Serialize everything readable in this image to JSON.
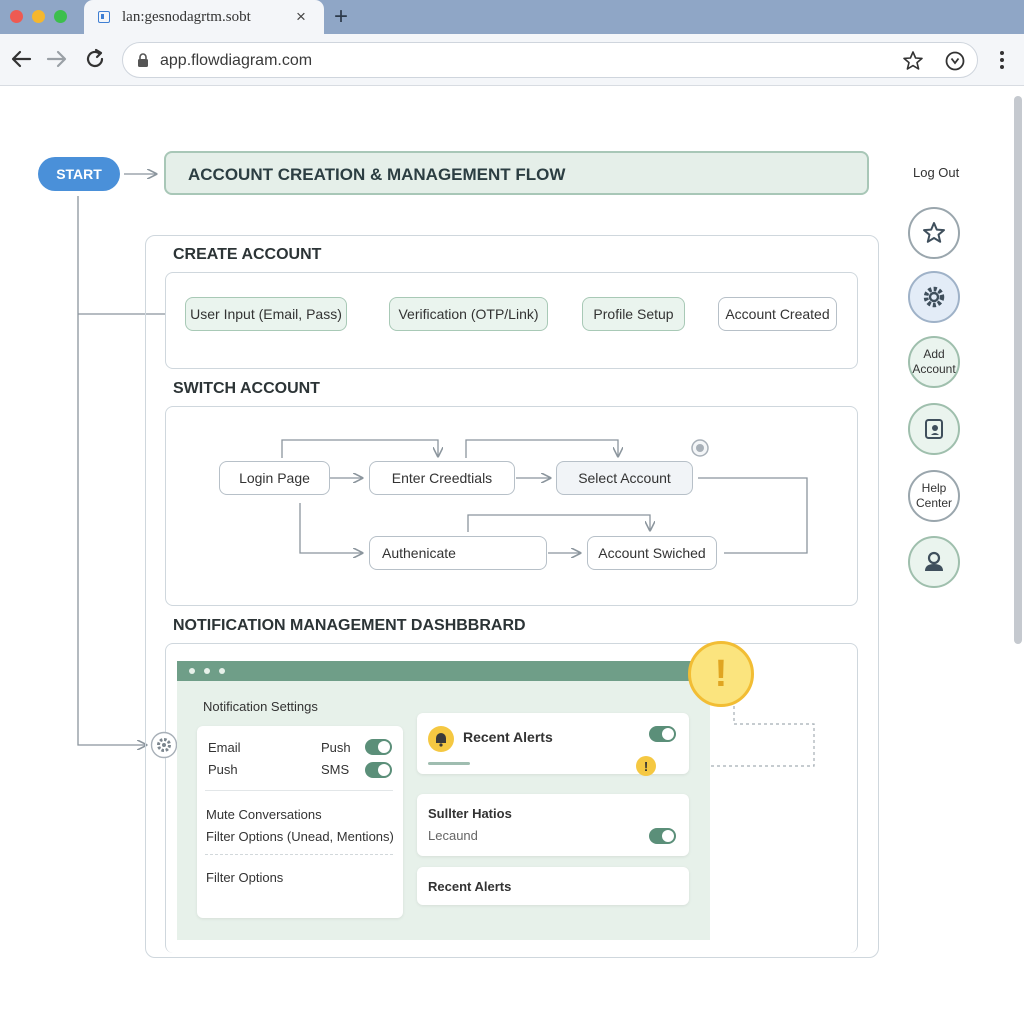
{
  "browser": {
    "tab_title": "lan:gesnodagrtm.sobt",
    "new_tab": "+",
    "close": "×",
    "url": "app.flowdiagram.com"
  },
  "colors": {
    "accent": "#4a90d9",
    "green": "#6f9e88",
    "alert": "#f5c842"
  },
  "header": {
    "start": "START",
    "title": "ACCOUNT CREATION & MANAGEMENT FLOW",
    "logout": "Log Out"
  },
  "create": {
    "title": "CREATE ACCOUNT",
    "steps": [
      "User Input (Email, Pass)",
      "Verification (OTP/Link)",
      "Profile Setup",
      "Account Created"
    ]
  },
  "switch": {
    "title": "SWITCH ACCOUNT",
    "nodes": [
      "Login Page",
      "Enter Creedtials",
      "Select Account",
      "Authenicate",
      "Account Swiched"
    ]
  },
  "notif": {
    "title": "NOTIFICATION MANAGEMENT DASHBBRARD",
    "settings_title": "Notification Settings",
    "rows": [
      {
        "left": "Email",
        "right": "Push"
      },
      {
        "left": "Push",
        "right": "SMS"
      }
    ],
    "mute": "Mute Conversations",
    "filter_full": "Filter Options (Unead, Mentions)",
    "filter": "Filter Options",
    "recent_alerts": "Recent Alerts",
    "sulter_title": "Sullter Hatios",
    "lecaund": "Lecaund",
    "recent_alerts_2": "Recent Alerts",
    "alert_mark": "!"
  },
  "side": {
    "add_line1": "Add",
    "add_line2": "Account",
    "help_line1": "Help",
    "help_line2": "Center"
  }
}
